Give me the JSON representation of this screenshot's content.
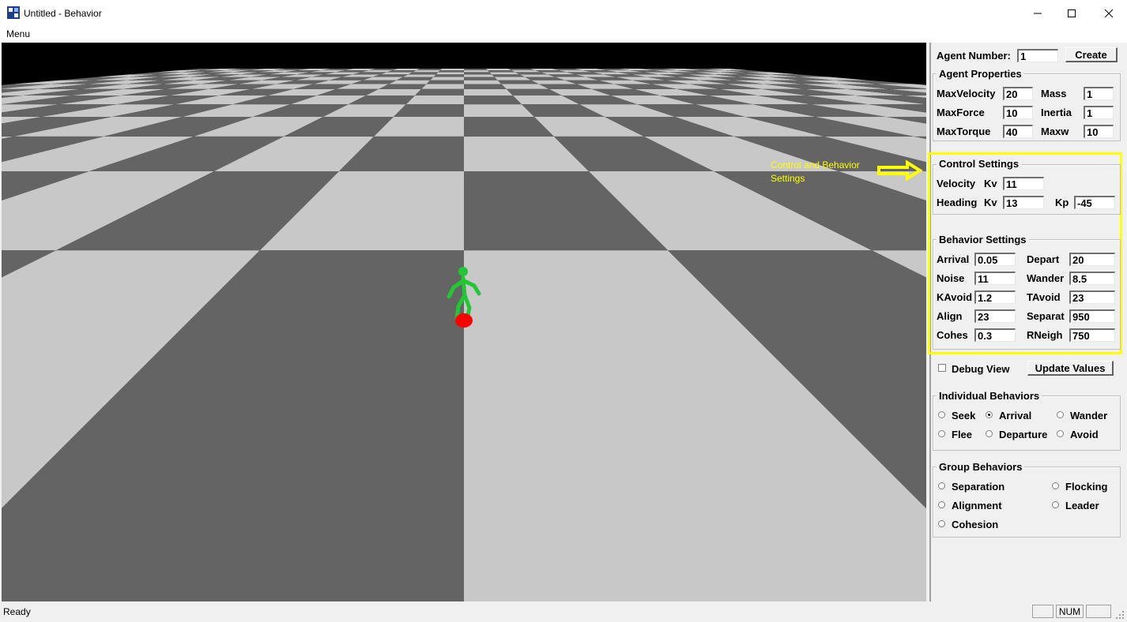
{
  "window": {
    "title": "Untitled - Behavior",
    "menu": "Menu"
  },
  "agent": {
    "number_label": "Agent Number:",
    "number_value": "1",
    "create_button": "Create"
  },
  "agent_properties": {
    "title": "Agent Properties",
    "max_velocity_label": "MaxVelocity",
    "max_velocity": "20",
    "mass_label": "Mass",
    "mass": "1",
    "max_force_label": "MaxForce",
    "max_force": "10",
    "inertia_label": "Inertia",
    "inertia": "1",
    "max_torque_label": "MaxTorque",
    "max_torque": "40",
    "maxw_label": "Maxw",
    "maxw": "10"
  },
  "annotation": {
    "text_line1": "Control and Behavior",
    "text_line2": "Settings",
    "color": "#ffff00"
  },
  "control_settings": {
    "title": "Control Settings",
    "velocity_label": "Velocity",
    "velocity_kv_label": "Kv",
    "velocity_kv": "11",
    "heading_label": "Heading",
    "heading_kv_label": "Kv",
    "heading_kv": "13",
    "kp_label": "Kp",
    "kp": "-45"
  },
  "behavior_settings": {
    "title": "Behavior Settings",
    "arrival_label": "Arrival",
    "arrival": "0.05",
    "depart_label": "Depart",
    "depart": "20",
    "noise_label": "Noise",
    "noise": "11",
    "wander_label": "Wander",
    "wander": "8.5",
    "kavoid_label": "KAvoid",
    "kavoid": "1.2",
    "tavoid_label": "TAvoid",
    "tavoid": "23",
    "align_label": "Align",
    "align": "23",
    "separat_label": "Separat",
    "separat": "950",
    "cohes_label": "Cohes",
    "cohes": "0.3",
    "rneigh_label": "RNeigh",
    "rneigh": "750"
  },
  "debug": {
    "label": "Debug View",
    "checked": false,
    "update_button": "Update Values"
  },
  "individual_behaviors": {
    "title": "Individual Behaviors",
    "seek": "Seek",
    "arrival": "Arrival",
    "wander": "Wander",
    "flee": "Flee",
    "departure": "Departure",
    "avoid": "Avoid",
    "selected": "Arrival"
  },
  "group_behaviors": {
    "title": "Group Behaviors",
    "separation": "Separation",
    "flocking": "Flocking",
    "alignment": "Alignment",
    "leader": "Leader",
    "cohesion": "Cohesion"
  },
  "status": {
    "text": "Ready",
    "num": "NUM"
  },
  "scene": {
    "floor_light": "#c8c8c8",
    "floor_dark": "#646464",
    "agent_color": "#22c833",
    "target_color": "#ff0000"
  }
}
